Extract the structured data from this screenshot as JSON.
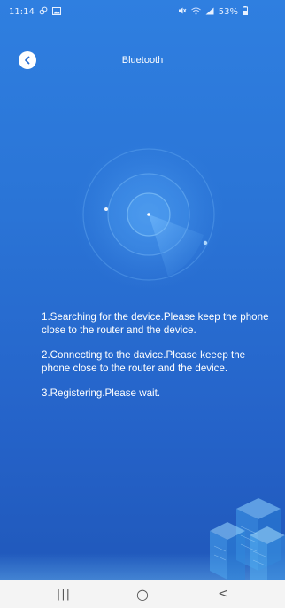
{
  "status_bar": {
    "time": "11:14",
    "battery": "53%"
  },
  "header": {
    "title": "Bluetooth",
    "back_icon": "chevron-left-icon"
  },
  "steps": [
    {
      "text": "1.Searching for the device.Please keep the phone close to the router and the device."
    },
    {
      "text": "2.Connecting to the davice.Please keeep the phone close to the router and the device."
    },
    {
      "text": "3.Registering.Please wait."
    }
  ],
  "nav_bar": {
    "recents_glyph": "|||",
    "home_glyph": "○",
    "back_glyph": "<"
  },
  "colors": {
    "background": "#2a74d6",
    "text": "#ffffff",
    "nav_bar": "#f4f4f4"
  }
}
